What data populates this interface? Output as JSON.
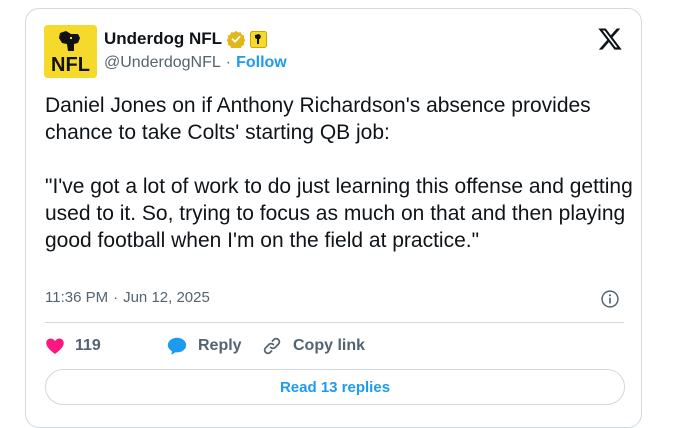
{
  "author": {
    "name": "Underdog NFL",
    "handle": "@UnderdogNFL",
    "separator": "·",
    "follow_label": "Follow",
    "avatar_text": "NFL"
  },
  "tweet": {
    "text": "Daniel Jones on if Anthony Richardson's absence provides chance to take Colts' starting QB job:\n\n\"I've got a lot of work to do just learning this offense and getting used to it. So, trying to focus as much on that and then playing good football when I'm on the field at practice.\"",
    "time": "11:36 PM",
    "separator": "·",
    "date": "Jun 12, 2025"
  },
  "actions": {
    "likes": "119",
    "reply_label": "Reply",
    "copy_label": "Copy link"
  },
  "read_replies_label": "Read 13 replies",
  "colors": {
    "accent": "#1d9bf0",
    "like": "#f91880",
    "avatar_bg": "#f5d92b",
    "verified": "#e2b719"
  }
}
